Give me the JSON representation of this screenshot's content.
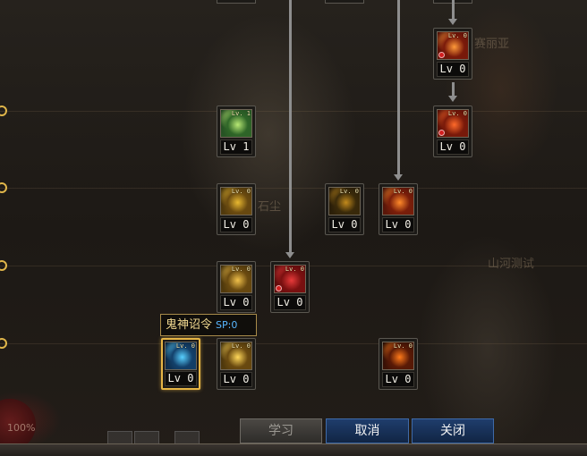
{
  "skill_tree": {
    "skills": [
      {
        "id": "green",
        "level_tag": "Lv. 1",
        "level_label": "Lv 1",
        "learnable_warning": false,
        "selected": false,
        "colors": [
          "#1f4420",
          "#b8e874",
          "#2f6628"
        ]
      },
      {
        "id": "gold-a",
        "level_tag": "Lv. 0",
        "level_label": "Lv 0",
        "learnable_warning": false,
        "selected": false,
        "colors": [
          "#3a2a08",
          "#e8b830",
          "#6a4a10"
        ]
      },
      {
        "id": "dark-gold",
        "level_tag": "Lv. 0",
        "level_label": "Lv 0",
        "learnable_warning": false,
        "selected": false,
        "colors": [
          "#1e1508",
          "#c28a1c",
          "#3a2a0a"
        ]
      },
      {
        "id": "red-fist",
        "level_tag": "Lv. 0",
        "level_label": "Lv 0",
        "learnable_warning": false,
        "selected": false,
        "colors": [
          "#401008",
          "#ff8a2a",
          "#7a1e0a"
        ]
      },
      {
        "id": "gold-b",
        "level_tag": "Lv. 0",
        "level_label": "Lv 0",
        "learnable_warning": false,
        "selected": false,
        "colors": [
          "#3a2a08",
          "#f0c04a",
          "#6a4a10"
        ]
      },
      {
        "id": "red-pillar",
        "level_tag": "Lv. 0",
        "level_label": "Lv 0",
        "learnable_warning": true,
        "selected": false,
        "colors": [
          "#4a0808",
          "#e83a3a",
          "#7a1010"
        ]
      },
      {
        "id": "blue-spirit",
        "level_tag": "Lv. 0",
        "level_label": "Lv 0",
        "learnable_warning": false,
        "selected": true,
        "colors": [
          "#0a1e34",
          "#58d0ff",
          "#13406a"
        ]
      },
      {
        "id": "gold-c",
        "level_tag": "Lv. 0",
        "level_label": "Lv 0",
        "learnable_warning": false,
        "selected": false,
        "colors": [
          "#3a2a08",
          "#ffd85a",
          "#6a4a10"
        ]
      },
      {
        "id": "fire",
        "level_tag": "Lv. 0",
        "level_label": "Lv 0",
        "learnable_warning": false,
        "selected": false,
        "colors": [
          "#200a04",
          "#ff7a1a",
          "#5a1a06"
        ]
      },
      {
        "id": "red-top",
        "level_tag": "Lv. 0",
        "level_label": "Lv 0",
        "learnable_warning": true,
        "selected": false,
        "colors": [
          "#4a0c06",
          "#ff9a3a",
          "#7a1a0a"
        ]
      },
      {
        "id": "red-mid",
        "level_tag": "Lv. 0",
        "level_label": "Lv 0",
        "learnable_warning": true,
        "selected": false,
        "colors": [
          "#4a0c06",
          "#ff6a2a",
          "#7a1a0a"
        ]
      }
    ]
  },
  "tooltip": {
    "skill_name": "鬼神诏令",
    "sp": "SP:0"
  },
  "background_text": {
    "npc1": "赛丽亚",
    "npc2": "石尘",
    "npc3": "山河测试",
    "hp": "100%"
  },
  "buttons": {
    "learn": "学习",
    "cancel": "取消",
    "close": "关闭"
  }
}
